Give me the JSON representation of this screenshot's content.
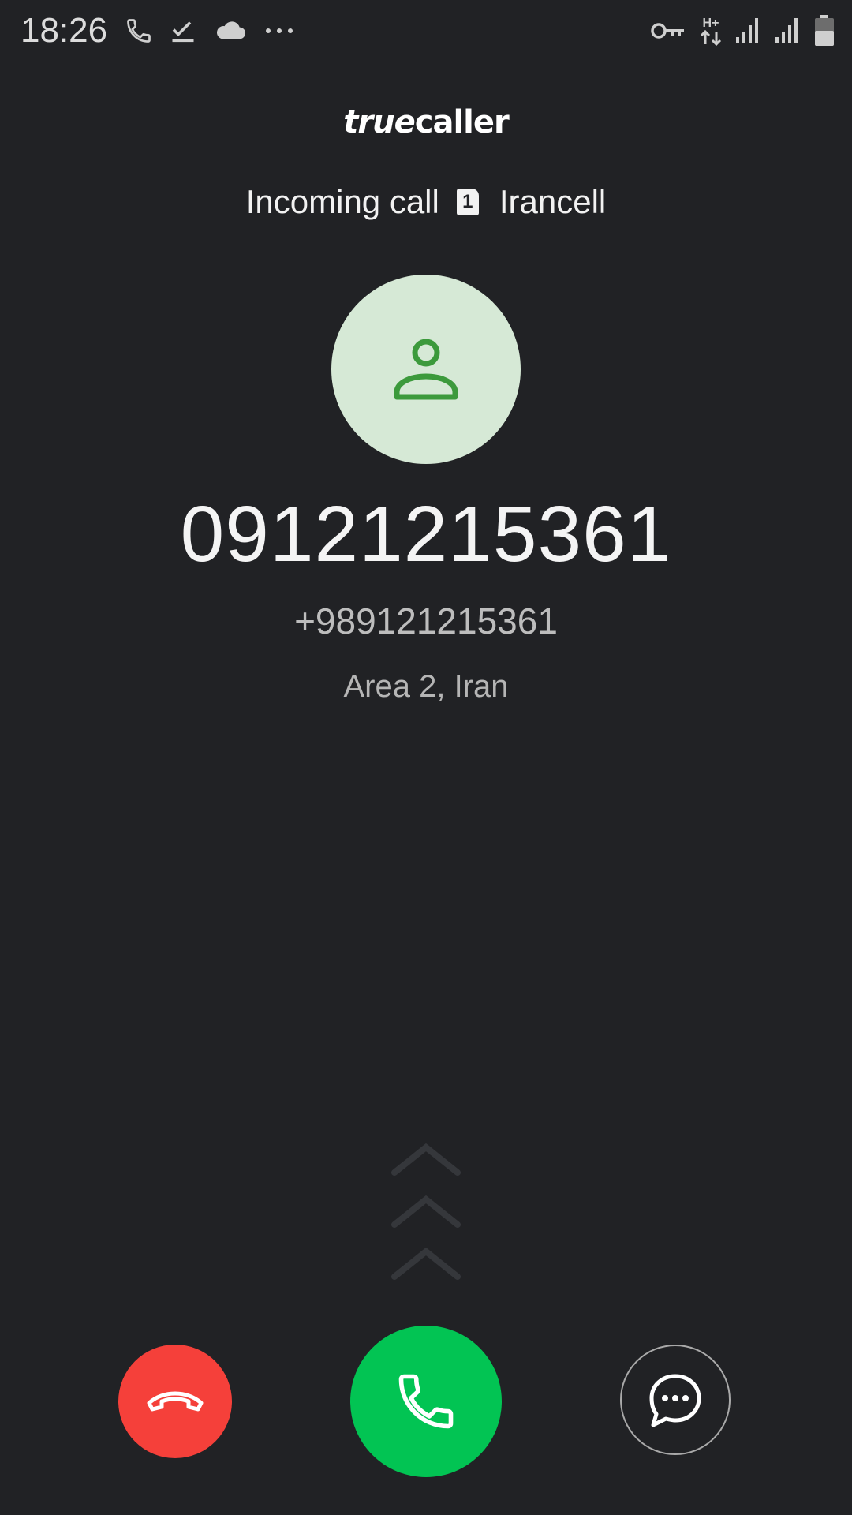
{
  "status_bar": {
    "time": "18:26",
    "left_icons": [
      "phone-icon",
      "task-done-icon",
      "cloud-icon",
      "more-dots-icon"
    ],
    "right_icons": [
      "vpn-key-icon",
      "network-hplus-icon",
      "signal-sim1-icon",
      "signal-sim2-icon",
      "battery-icon"
    ],
    "network_type": "H+"
  },
  "header": {
    "brand_part1": "true",
    "brand_part2": "caller"
  },
  "call": {
    "status_text": "Incoming call",
    "sim_slot": "1",
    "carrier": "Irancell"
  },
  "caller": {
    "avatar_icon": "person-icon",
    "number": "09121215361",
    "international_number": "+989121215361",
    "location": "Area 2, Iran"
  },
  "actions": {
    "decline_icon": "hang-up-icon",
    "answer_icon": "phone-icon",
    "message_icon": "chat-bubble-icon"
  },
  "colors": {
    "background": "#212225",
    "decline": "#f5403a",
    "answer": "#02c453",
    "avatar_bg": "#d6e9d6",
    "avatar_icon": "#3c9a3c"
  }
}
